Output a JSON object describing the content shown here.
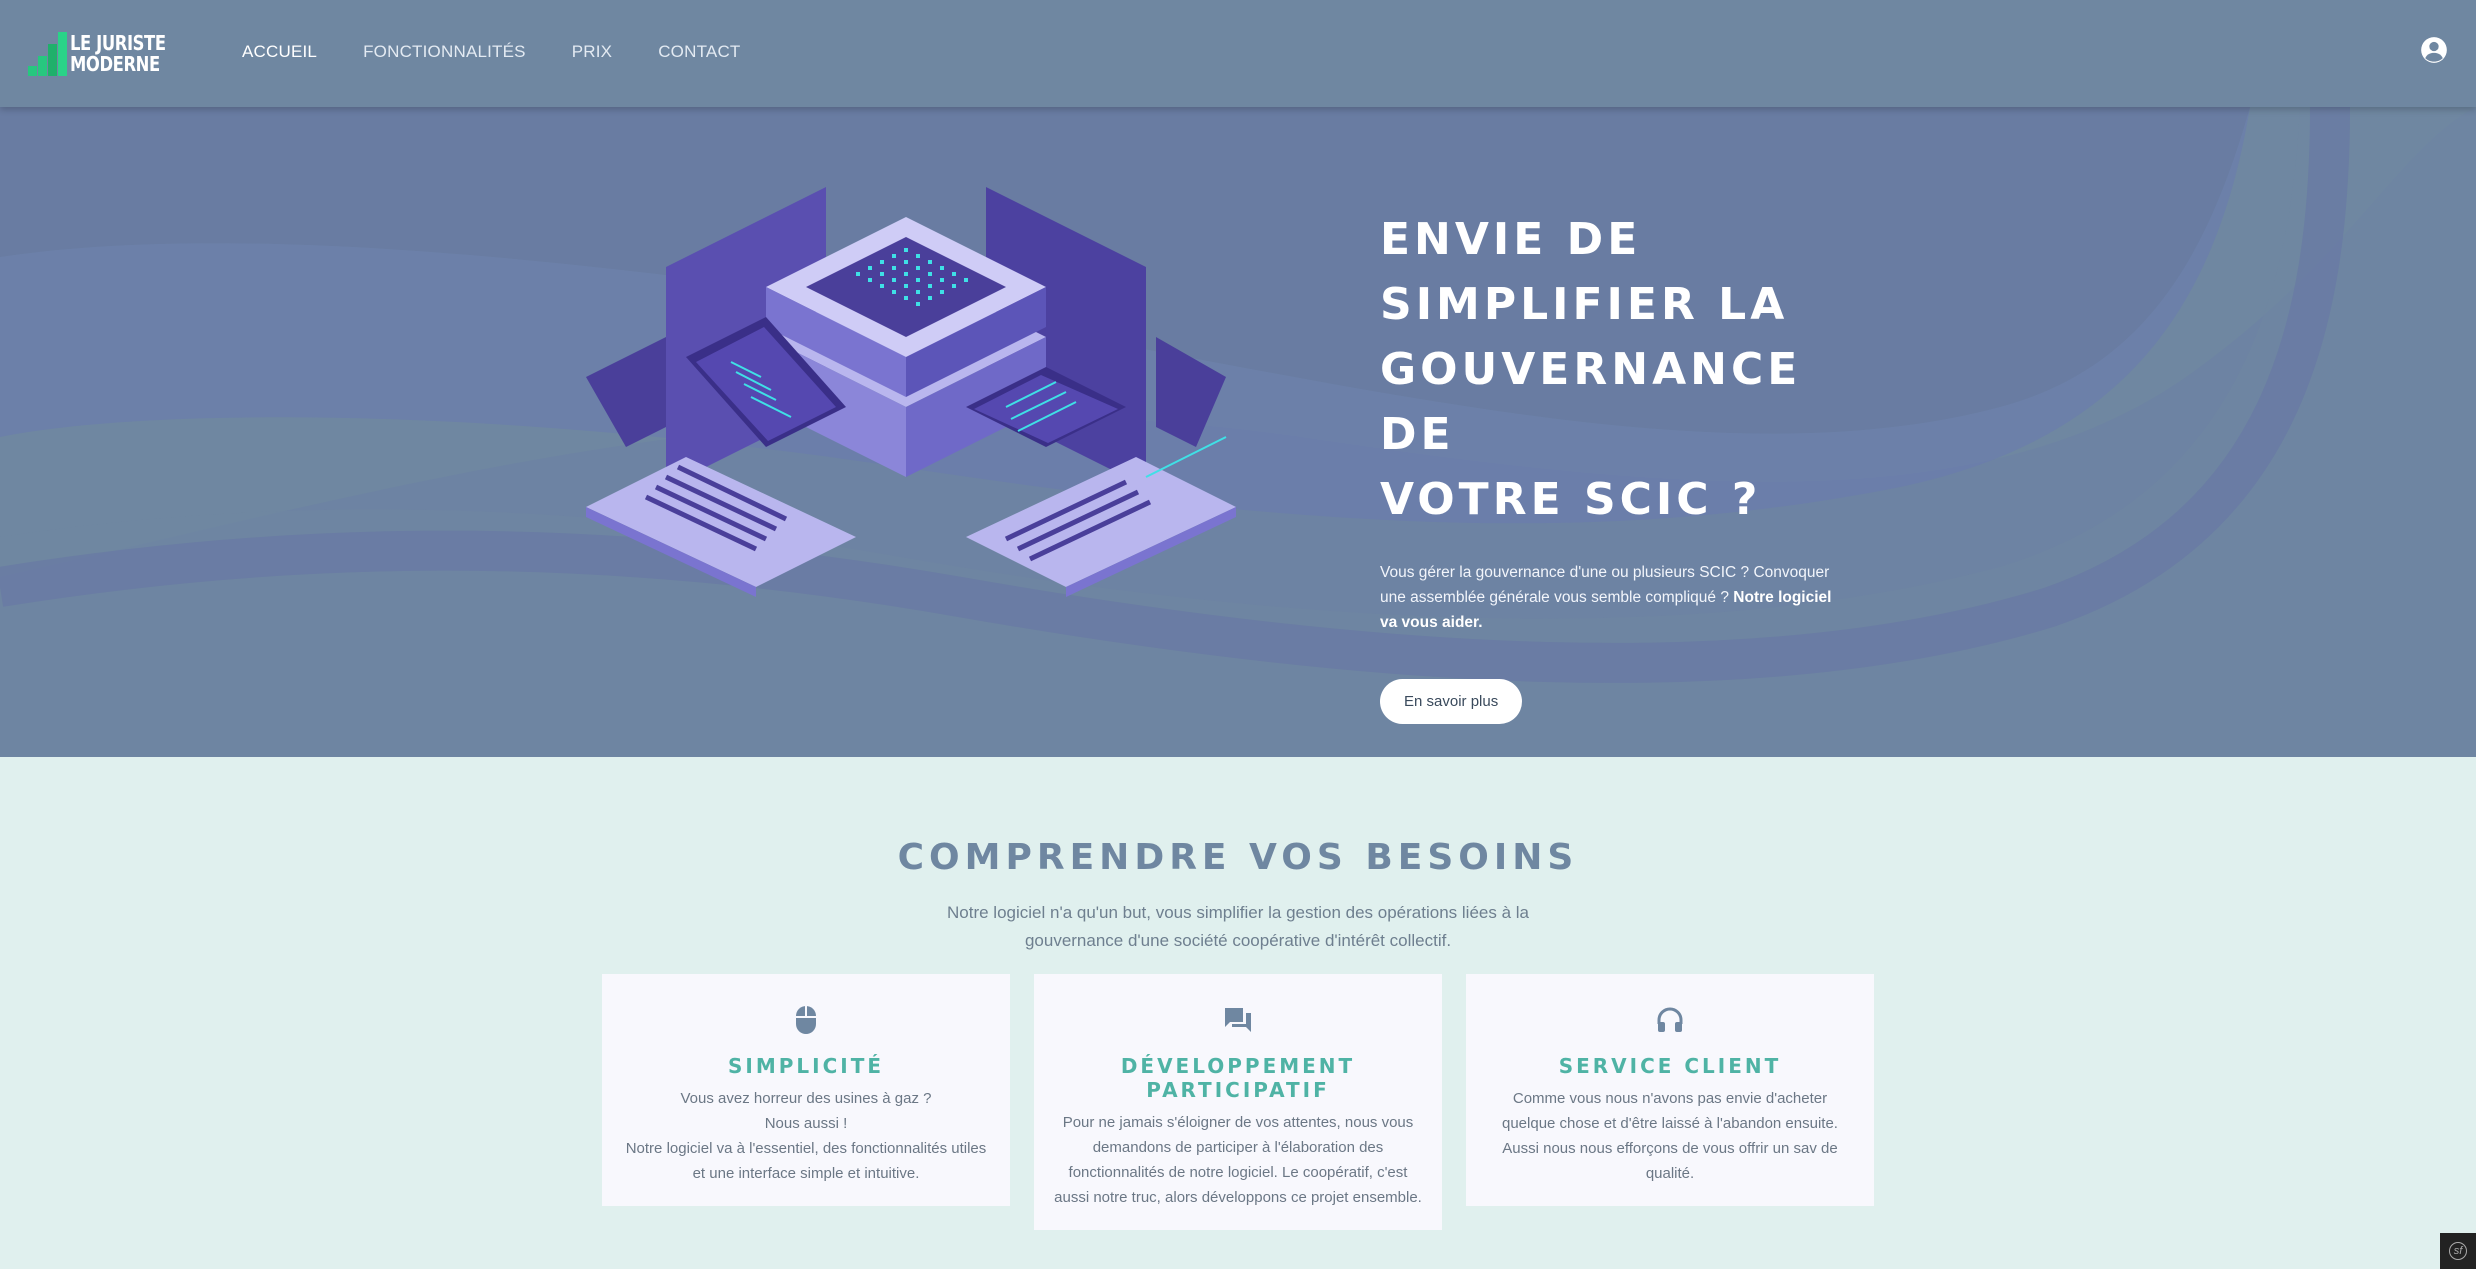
{
  "brand": {
    "line1": "LE JURISTE",
    "line2": "MODERNE",
    "accent_color": "#27c77f"
  },
  "nav": {
    "items": [
      {
        "label": "ACCUEIL",
        "active": true
      },
      {
        "label": "FONCTIONNALITÉS",
        "active": false
      },
      {
        "label": "PRIX",
        "active": false
      },
      {
        "label": "CONTACT",
        "active": false
      }
    ],
    "account_icon": "account-circle-icon"
  },
  "hero": {
    "title_lines": [
      "ENVIE DE",
      "SIMPLIFIER LA",
      "GOUVERNANCE DE",
      "VOTRE SCIC ?"
    ],
    "description": "Vous gérer la gouvernance d'une ou plusieurs SCIC ? Convoquer une assemblée générale vous semble compliqué ? ",
    "description_bold": "Notre logiciel va vous aider.",
    "button_label": "En savoir plus",
    "background_color": "#6f87a1"
  },
  "section": {
    "title": "COMPRENDRE VOS BESOINS",
    "subtitle": "Notre logiciel n'a qu'un but, vous simplifier la gestion des opérations liées à la gouvernance d'une société coopérative d'intérêt collectif.",
    "cards": [
      {
        "icon": "mouse-icon",
        "title": "SIMPLICITÉ",
        "lines": [
          "Vous avez horreur des usines à gaz ?",
          "Nous aussi !",
          "Notre logiciel va à l'essentiel, des fonctionnalités utiles et une interface simple et intuitive."
        ]
      },
      {
        "icon": "chat-icon",
        "title": "DÉVELOPPEMENT PARTICIPATIF",
        "lines": [
          "Pour ne jamais s'éloigner de vos attentes, nous vous demandons de participer à l'élaboration des fonctionnalités de notre logiciel. Le coopératif, c'est aussi notre truc, alors développons ce projet ensemble."
        ]
      },
      {
        "icon": "headset-icon",
        "title": "SERVICE CLIENT",
        "lines": [
          "Comme vous nous n'avons pas envie d'acheter quelque chose et d'être laissé à l'abandon ensuite. Aussi nous nous efforçons de vous offrir un sav de qualité."
        ]
      }
    ],
    "title_color": "#6f87a1",
    "card_title_color": "#4fb3a5"
  }
}
